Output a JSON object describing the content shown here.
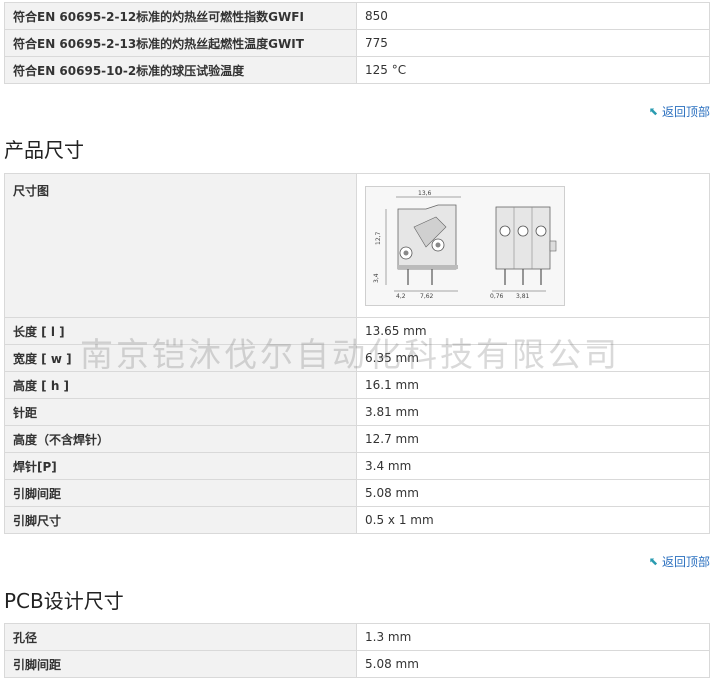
{
  "top_table": [
    {
      "label": "符合EN 60695-2-12标准的灼热丝可燃性指数GWFI",
      "value": "850"
    },
    {
      "label": "符合EN 60695-2-13标准的灼热丝起燃性温度GWIT",
      "value": "775"
    },
    {
      "label": "符合EN 60695-10-2标准的球压试验温度",
      "value": "125 °C"
    }
  ],
  "back_to_top": "返回顶部",
  "dimensions": {
    "title": "产品尺寸",
    "drawing_label": "尺寸图",
    "drawing_annotations": {
      "width": "13,6",
      "height": "12,7",
      "pin": "3,4",
      "a": "4,2",
      "b": "7,62",
      "c": "0,76",
      "d": "3,81"
    },
    "rows": [
      {
        "label": "长度 [ l ]",
        "value": "13.65 mm"
      },
      {
        "label": "宽度 [ w ]",
        "value": "6.35 mm"
      },
      {
        "label": "高度 [ h ]",
        "value": "16.1 mm"
      },
      {
        "label": "针距",
        "value": "3.81 mm"
      },
      {
        "label": "高度（不含焊针）",
        "value": "12.7 mm"
      },
      {
        "label": "焊针[P]",
        "value": "3.4 mm"
      },
      {
        "label": "引脚间距",
        "value": "5.08 mm"
      },
      {
        "label": "引脚尺寸",
        "value": "0.5 x 1 mm"
      }
    ]
  },
  "pcb": {
    "title": "PCB设计尺寸",
    "rows": [
      {
        "label": "孔径",
        "value": "1.3 mm"
      },
      {
        "label": "引脚间距",
        "value": "5.08 mm"
      }
    ]
  },
  "watermark": "南京铠沐伐尔自动化科技有限公司"
}
